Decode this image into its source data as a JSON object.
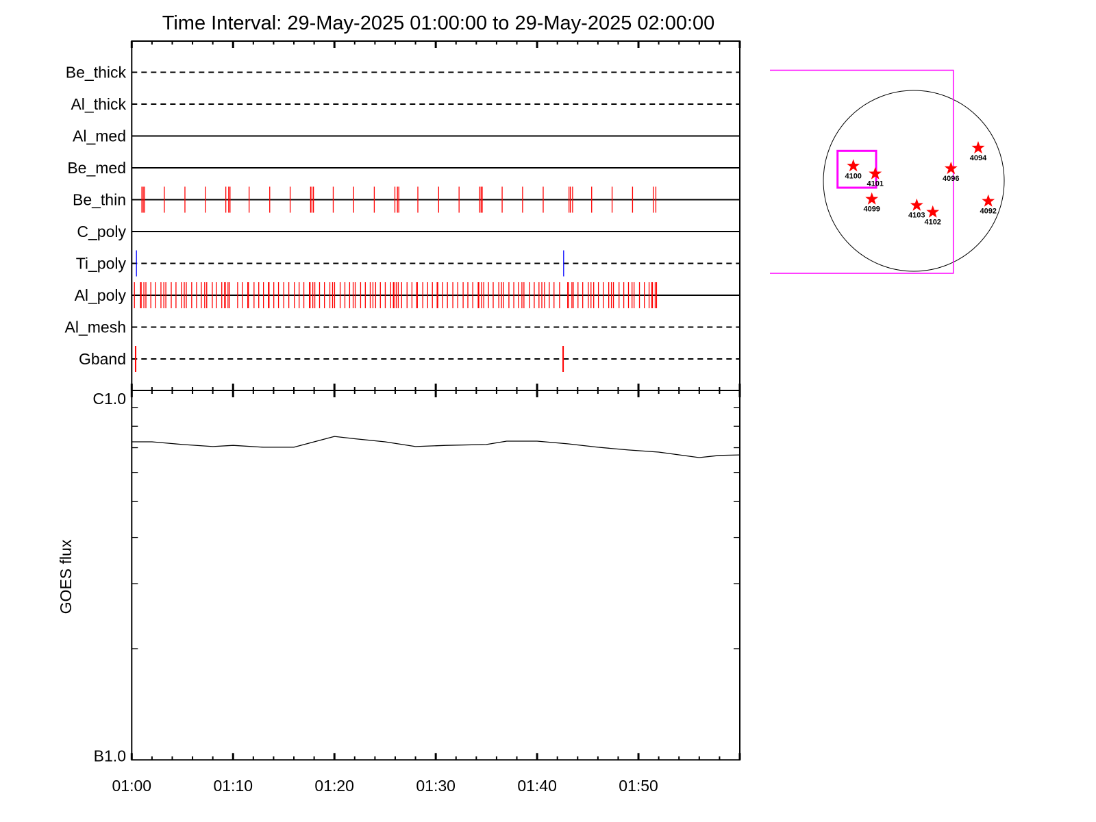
{
  "title": "Time Interval: 29-May-2025 01:00:00 to 29-May-2025 02:00:00",
  "chart_data": [
    {
      "type": "scatter",
      "xrange": [
        "01:00:00",
        "02:00:00"
      ],
      "x_tick_labels": [
        "01:00",
        "01:10",
        "01:20",
        "01:30",
        "01:40",
        "01:50"
      ],
      "rows": [
        {
          "label": "Be_thick",
          "line": "dashed",
          "events": []
        },
        {
          "label": "Al_thick",
          "line": "dashed",
          "events": []
        },
        {
          "label": "Al_med",
          "line": "solid",
          "events": []
        },
        {
          "label": "Be_med",
          "line": "solid",
          "events": []
        },
        {
          "label": "Be_thin",
          "line": "solid",
          "color": "#ff0000",
          "events": [
            "01:01:00",
            "01:01:08",
            "01:01:16",
            "01:03:13",
            "01:05:15",
            "01:07:16",
            "01:09:17",
            "01:09:34",
            "01:09:42",
            "01:11:35",
            "01:13:37",
            "01:15:38",
            "01:17:39",
            "01:17:47",
            "01:17:56",
            "01:19:53",
            "01:21:54",
            "01:23:56",
            "01:25:58",
            "01:26:13",
            "01:26:21",
            "01:28:14",
            "01:30:17",
            "01:32:18",
            "01:34:19",
            "01:34:28",
            "01:34:35",
            "01:36:33",
            "01:38:34",
            "01:40:36",
            "01:43:09",
            "01:43:17",
            "01:43:30",
            "01:45:23",
            "01:47:24",
            "01:49:25",
            "01:51:28",
            "01:51:43"
          ]
        },
        {
          "label": "C_poly",
          "line": "solid",
          "events": []
        },
        {
          "label": "Ti_poly",
          "line": "dashed",
          "color": "#0000ff",
          "events": [
            "01:00:28",
            "01:42:37"
          ]
        },
        {
          "label": "Al_poly",
          "line": "solid",
          "color": "#ff0000",
          "events": [
            "01:00:16",
            "01:00:52",
            "01:00:56",
            "01:01:12",
            "01:01:24",
            "01:01:53",
            "01:02:21",
            "01:02:53",
            "01:03:10",
            "01:03:22",
            "01:03:54",
            "01:04:22",
            "01:04:55",
            "01:05:11",
            "01:05:23",
            "01:05:55",
            "01:06:24",
            "01:06:52",
            "01:07:12",
            "01:07:24",
            "01:07:57",
            "01:08:21",
            "01:08:53",
            "01:09:10",
            "01:09:14",
            "01:09:30",
            "01:09:38",
            "01:10:27",
            "01:10:55",
            "01:11:27",
            "01:11:31",
            "01:12:04",
            "01:12:32",
            "01:13:00",
            "01:13:29",
            "01:13:33",
            "01:14:01",
            "01:14:29",
            "01:15:00",
            "01:15:30",
            "01:16:03",
            "01:16:31",
            "01:16:59",
            "01:17:32",
            "01:17:36",
            "01:17:52",
            "01:18:04",
            "01:18:32",
            "01:19:01",
            "01:19:33",
            "01:19:49",
            "01:20:01",
            "01:20:34",
            "01:21:02",
            "01:21:30",
            "01:21:51",
            "01:22:03",
            "01:22:35",
            "01:23:03",
            "01:23:32",
            "01:23:48",
            "01:24:04",
            "01:24:32",
            "01:25:01",
            "01:25:33",
            "01:25:49",
            "01:25:53",
            "01:26:06",
            "01:26:18",
            "01:26:38",
            "01:27:10",
            "01:27:39",
            "01:28:07",
            "01:28:11",
            "01:28:43",
            "01:29:12",
            "01:29:40",
            "01:30:08",
            "01:30:12",
            "01:30:41",
            "01:31:09",
            "01:31:41",
            "01:32:10",
            "01:32:42",
            "01:33:10",
            "01:33:39",
            "01:34:11",
            "01:34:15",
            "01:34:31",
            "01:34:44",
            "01:35:12",
            "01:35:40",
            "01:36:13",
            "01:36:29",
            "01:36:41",
            "01:37:13",
            "01:37:42",
            "01:38:10",
            "01:38:30",
            "01:38:42",
            "01:39:15",
            "01:39:43",
            "01:40:11",
            "01:40:28",
            "01:40:44",
            "01:41:12",
            "01:41:40",
            "01:42:13",
            "01:43:01",
            "01:43:05",
            "01:43:26",
            "01:43:34",
            "01:44:02",
            "01:44:30",
            "01:45:03",
            "01:45:19",
            "01:45:35",
            "01:46:03",
            "01:46:32",
            "01:47:04",
            "01:47:20",
            "01:47:32",
            "01:48:05",
            "01:48:33",
            "01:49:01",
            "01:49:22",
            "01:49:34",
            "01:50:06",
            "01:50:35",
            "01:51:03",
            "01:51:19",
            "01:51:23",
            "01:51:39",
            "01:51:47"
          ]
        },
        {
          "label": "Al_mesh",
          "line": "dashed",
          "events": []
        },
        {
          "label": "Gband",
          "line": "dashed",
          "color": "#ff0000",
          "events": [
            "01:00:23",
            "01:42:34"
          ]
        }
      ]
    },
    {
      "type": "line",
      "ylabel": "GOES flux",
      "yscale": "log",
      "ylim": [
        1e-07,
        1e-06
      ],
      "y_tick_labels": [
        "C1.0",
        "B1.0"
      ],
      "xrange": [
        "01:00:00",
        "02:00:00"
      ],
      "x_tick_labels": [
        "01:00",
        "01:10",
        "01:20",
        "01:30",
        "01:40",
        "01:50"
      ],
      "points": [
        [
          "01:00:00",
          7.26e-07
        ],
        [
          "01:02:00",
          7.26e-07
        ],
        [
          "01:05:00",
          7.14e-07
        ],
        [
          "01:08:00",
          7.05e-07
        ],
        [
          "01:10:00",
          7.1e-07
        ],
        [
          "01:13:00",
          7.02e-07
        ],
        [
          "01:16:00",
          7.02e-07
        ],
        [
          "01:18:00",
          7.26e-07
        ],
        [
          "01:20:00",
          7.51e-07
        ],
        [
          "01:22:00",
          7.4e-07
        ],
        [
          "01:25:00",
          7.26e-07
        ],
        [
          "01:28:00",
          7.05e-07
        ],
        [
          "01:31:00",
          7.1e-07
        ],
        [
          "01:35:00",
          7.14e-07
        ],
        [
          "01:37:00",
          7.29e-07
        ],
        [
          "01:40:00",
          7.29e-07
        ],
        [
          "01:43:00",
          7.17e-07
        ],
        [
          "01:46:00",
          7.02e-07
        ],
        [
          "01:49:00",
          6.9e-07
        ],
        [
          "01:52:00",
          6.81e-07
        ],
        [
          "01:56:00",
          6.58e-07
        ],
        [
          "01:58:00",
          6.67e-07
        ],
        [
          "02:00:00",
          6.69e-07
        ]
      ]
    }
  ],
  "sun_map": {
    "fov_color": "#ff00ff",
    "star_color": "#ff0000",
    "regions": [
      "4100",
      "4101",
      "4099",
      "4103",
      "4102",
      "4096",
      "4094",
      "4092"
    ]
  }
}
